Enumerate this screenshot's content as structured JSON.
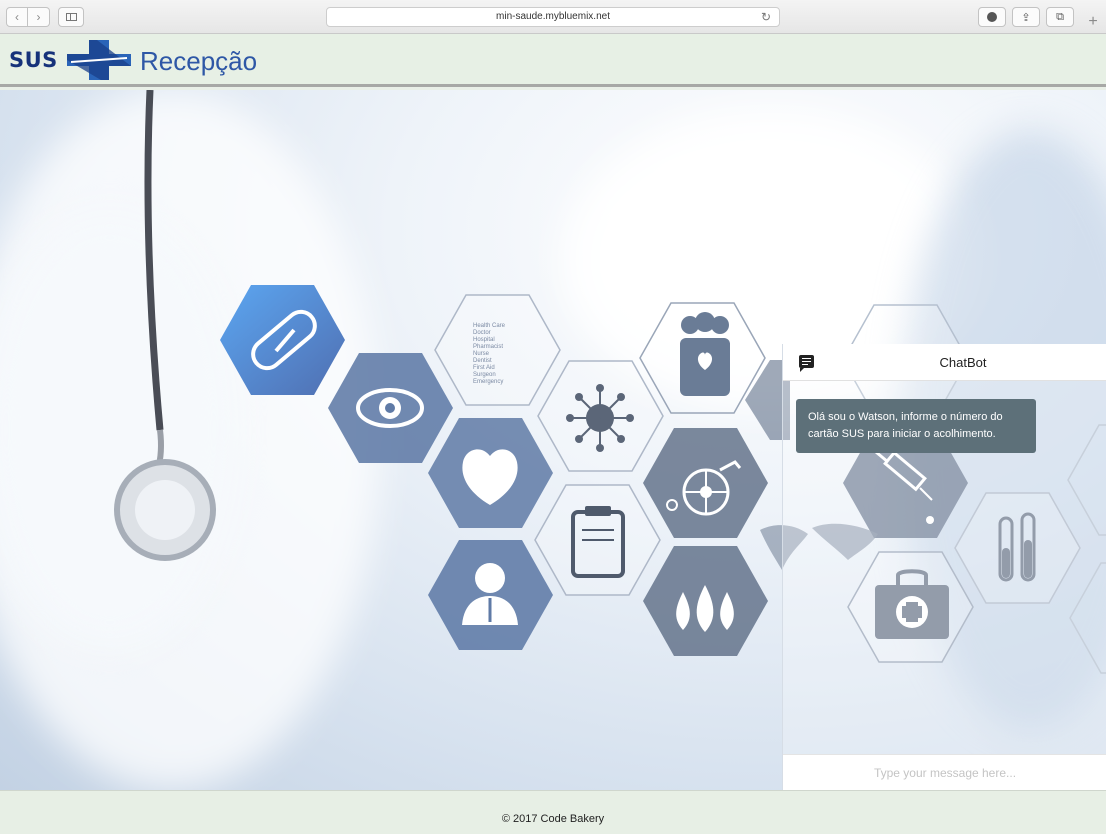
{
  "browser": {
    "url": "min-saude.mybluemix.net",
    "back_glyph": "‹",
    "forward_glyph": "›",
    "reload_glyph": "↻",
    "share_glyph": "⇪",
    "tabs_glyph": "⧉",
    "new_tab_glyph": "+"
  },
  "header": {
    "logo_text": "SUS",
    "title": "Recepção"
  },
  "hero": {
    "hex_caption_lines": [
      "Health Care",
      "Doctor",
      "Hospital",
      "Pharmacist",
      "Nurse",
      "Dentist",
      "First Aid",
      "Surgeon",
      "Emergency"
    ],
    "icons": [
      "pill-icon",
      "eye-icon",
      "heart-icon",
      "doctor-icon",
      "virus-icon",
      "clipboard-icon",
      "family-icon",
      "wheelchair-icon",
      "blood-drops-icon",
      "syringe-icon",
      "medical-kit-icon",
      "test-tubes-icon",
      "world-map-icon"
    ]
  },
  "chat": {
    "title": "ChatBot",
    "icon": "chat-icon",
    "message": "Olá sou o Watson, informe o número do cartão SUS para iniciar o acolhimento.",
    "input_placeholder": "Type your message here..."
  },
  "footer": {
    "text": "© 2017 Code Bakery"
  },
  "colors": {
    "brand_blue": "#2e57a6",
    "logo_navy": "#16327a",
    "header_bg": "#e7f0e5",
    "hex_fill": "#5f7aa6",
    "bubble_bg": "#5d7079"
  }
}
